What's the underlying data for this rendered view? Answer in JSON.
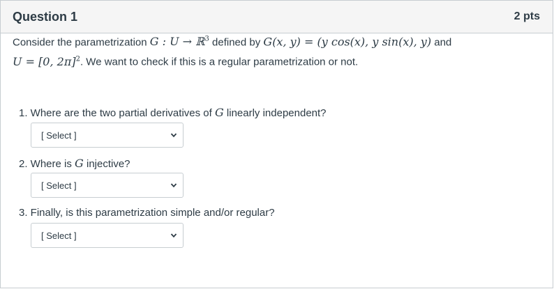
{
  "header": {
    "title": "Question 1",
    "points": "2 pts"
  },
  "intro": {
    "t1": "Consider the parametrization ",
    "m1": "G : U → ℝ",
    "m1_sup": "3",
    "t2": " defined by ",
    "m2": "G(x, y) = (y cos(x), y sin(x), y)",
    "t3": " and",
    "m3": "U = [0, 2π]",
    "m3_sup": "2",
    "t4": ". We want to check if this is a regular parametrization or not."
  },
  "items": [
    {
      "pre": "1. Where are the two partial derivatives of ",
      "math": "G",
      "post": " linearly independent?",
      "select": "[ Select ]"
    },
    {
      "pre": "2. Where is ",
      "math": "G",
      "post": " injective?",
      "select": "[ Select ]"
    },
    {
      "pre": "3. Finally, is this parametrization simple and/or regular?",
      "math": "",
      "post": "",
      "select": "[ Select ]"
    }
  ]
}
